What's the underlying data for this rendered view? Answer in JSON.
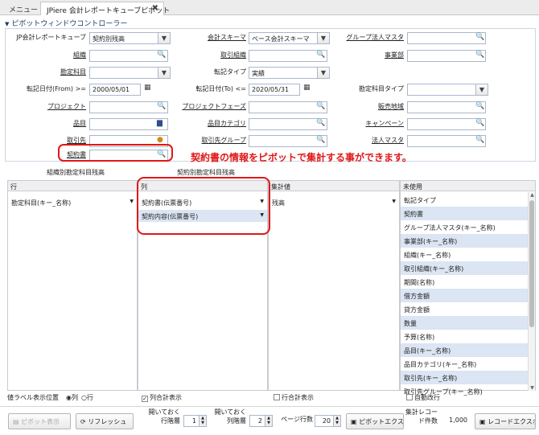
{
  "tabs": {
    "menu": "メニュー",
    "active": "JPiere 会計レポートキューブピボット",
    "close": "✖"
  },
  "panel_title": "ピボットウィンドウコントローラー",
  "form": {
    "cube_label": "JP会計レポートキューブ",
    "cube_value": "契約別残高",
    "schema_label": "会計スキーマ",
    "schema_value": "ベース会計スキーマ",
    "group_corp_label": "グループ法人マスタ",
    "group_corp_value": "",
    "org_label": "組織",
    "org_value": "",
    "trx_org_label": "取引組織",
    "trx_org_value": "",
    "business_unit_label": "事業部",
    "business_unit_value": "",
    "account_label": "勘定科目",
    "account_value": "",
    "posting_type_label": "転記タイプ",
    "posting_type_value": "実績",
    "date_from_label": "転記日付(From) >=",
    "date_from_value": "2000/05/01",
    "date_to_label": "転記日付(To) <=",
    "date_to_value": "2020/05/31",
    "account_type_label": "勘定科目タイプ",
    "account_type_value": "",
    "project_label": "プロジェクト",
    "project_value": "",
    "project_phase_label": "プロジェクトフェーズ",
    "project_phase_value": "",
    "sales_region_label": "販売地域",
    "sales_region_value": "",
    "product_label": "品目",
    "product_value": "",
    "product_category_label": "品目カテゴリ",
    "product_category_value": "",
    "campaign_label": "キャンペーン",
    "campaign_value": "",
    "bpartner_label": "取引先",
    "bpartner_value": "",
    "bp_group_label": "取引先グループ",
    "bp_group_value": "",
    "corp_master_label": "法人マスタ",
    "corp_master_value": "",
    "contract_label": "契約書",
    "contract_value": ""
  },
  "annotation": "契約書の情報をピボットで集計する事ができます。",
  "subtabs": {
    "left": "組織別勘定科目残高",
    "right": "契約別勘定科目残高"
  },
  "pivot": {
    "rows_header": "行",
    "rows_items": [
      "勘定科目(キー_名称)"
    ],
    "cols_header": "列",
    "cols_items": [
      "契約書(伝票番号)",
      "契約内容(伝票番号)"
    ],
    "values_header": "集計値",
    "values_items": [
      "残高"
    ],
    "unused_header": "未使用",
    "unused_items": [
      "転記タイプ",
      "契約書",
      "グループ法人マスタ(キー_名称)",
      "事業部(キー_名称)",
      "組織(キー_名称)",
      "取引組織(キー_名称)",
      "期間(名称)",
      "借方金額",
      "貸方金額",
      "数量",
      "予算(名称)",
      "品目(キー_名称)",
      "品目カテゴリ(キー_名称)",
      "取引先(キー_名称)",
      "取引先グループ(キー_名称)"
    ]
  },
  "options": {
    "label_position": "値ラベル表示位置",
    "opt_col": "列",
    "opt_row": "行",
    "col_total": "列合計表示",
    "row_total": "行合計表示",
    "auto_wrap": "自動改行"
  },
  "footer": {
    "pivot_display": "ピボット表示",
    "refresh": "リフレッシュ",
    "row_levels_label": "開いておく\n行階層",
    "row_levels_value": "1",
    "col_levels_label": "開いておく\n列階層",
    "col_levels_value": "2",
    "page_rows_label": "ページ行数",
    "page_rows_value": "20",
    "pivot_export": "ピボットエクスポー",
    "record_count_label": "集計レコー\nド件数",
    "record_count_value": "1,000",
    "record_export": "レコードエクスポー"
  }
}
